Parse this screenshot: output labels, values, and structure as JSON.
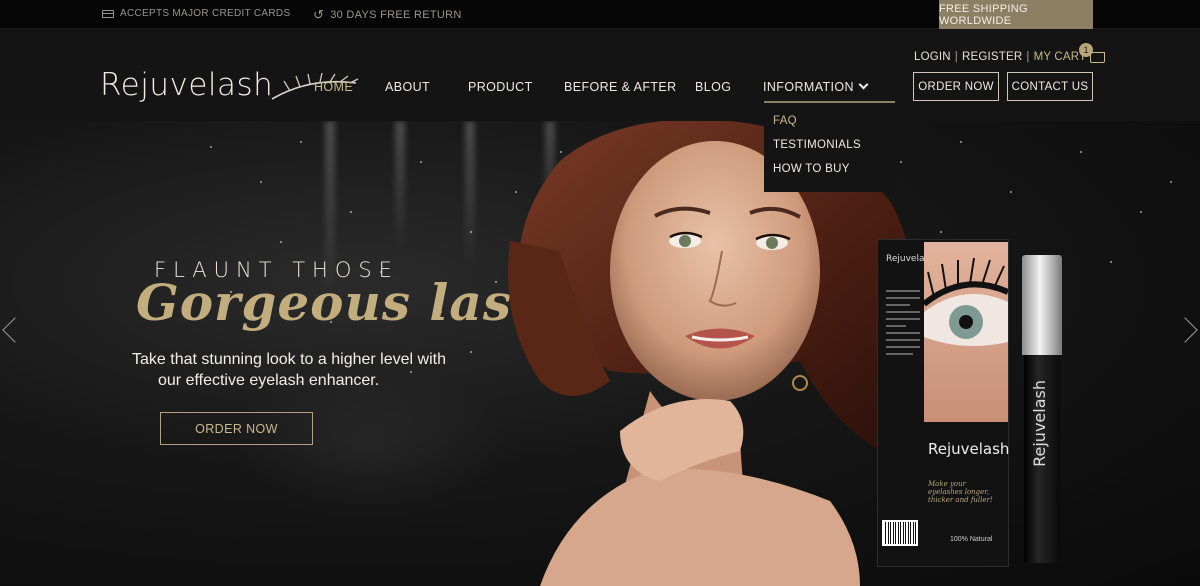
{
  "topbar": {
    "credit_cards": "ACCEPTS MAJOR CREDIT CARDS",
    "free_return": "30 DAYS FREE RETURN",
    "shipping": "FREE SHIPPING WORLDWIDE"
  },
  "header": {
    "logo": "Rejuvelash",
    "nav": [
      {
        "label": "HOME",
        "active": true
      },
      {
        "label": "ABOUT"
      },
      {
        "label": "PRODUCT"
      },
      {
        "label": "BEFORE & AFTER"
      },
      {
        "label": "BLOG"
      },
      {
        "label": "INFORMATION"
      }
    ],
    "account": {
      "login": "LOGIN",
      "register": "REGISTER",
      "cart": "MY CART",
      "cart_count": "1",
      "separator": "|"
    },
    "buttons": {
      "order_now": "ORDER NOW",
      "contact_us": "CONTACT US"
    }
  },
  "dropdown": {
    "items": [
      "FAQ",
      "TESTIMONIALS",
      "HOW TO BUY"
    ]
  },
  "hero": {
    "kicker": "FLAUNT THOSE",
    "headline": "Gorgeous lashes",
    "subtitle_line1": "Take that stunning look to a higher level with",
    "subtitle_line2": "our effective eyelash enhancer.",
    "cta": "ORDER NOW"
  },
  "product": {
    "box_brand": "Rejuvelash",
    "box_tagline": "Make your eyelashes longer, thicker and fuller!",
    "box_natural": "100% Natural",
    "tube_brand": "Rejuvelash"
  },
  "colors": {
    "accent_gold": "#c9b88a",
    "badge_bg": "#8c7f63",
    "header_bg": "#141414"
  }
}
